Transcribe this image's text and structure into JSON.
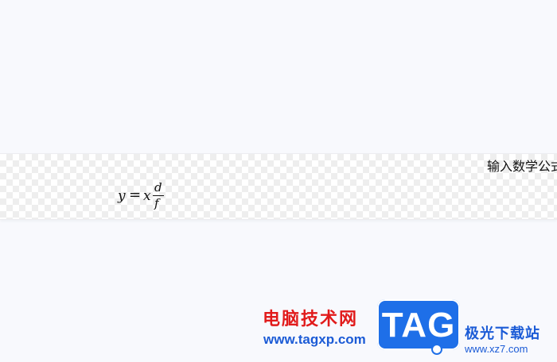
{
  "editor": {
    "placeholder": "输入数学公式",
    "formula": {
      "lhs": "y",
      "equals": "=",
      "x": "x",
      "numerator": "d",
      "denominator": "f"
    }
  },
  "watermark": {
    "cn_text": "电脑技术网",
    "url": "www.tagxp.com",
    "logo_text": "TAG",
    "site_cn": "极光下载站",
    "site_url": "www.xz7.com"
  }
}
